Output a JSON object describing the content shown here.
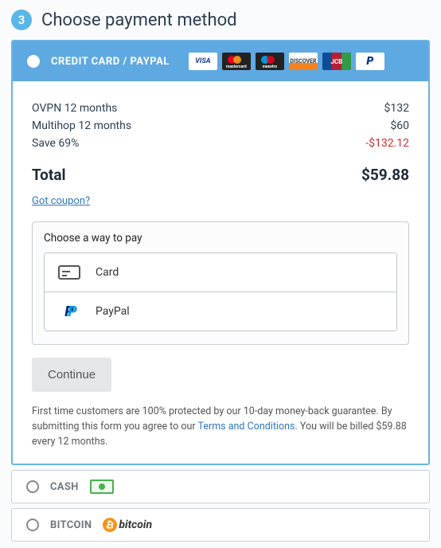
{
  "step": {
    "number": "3",
    "title": "Choose payment method"
  },
  "methods": {
    "credit": "CREDIT CARD / PAYPAL",
    "cash": "CASH",
    "bitcoin": "BITCOIN",
    "bitcoin_brand": "bitcoin"
  },
  "line_items": [
    {
      "label": "OVPN 12 months",
      "value": "$132"
    },
    {
      "label": "Multihop 12 months",
      "value": "$60"
    },
    {
      "label": "Save 69%",
      "value": "-$132.12"
    }
  ],
  "total": {
    "label": "Total",
    "value": "$59.88"
  },
  "coupon_link": "Got coupon?",
  "pay_box": {
    "title": "Choose a way to pay",
    "card": "Card",
    "paypal": "PayPal"
  },
  "continue_label": "Continue",
  "fine_print": {
    "pre": "First time customers are 100% protected by our 10-day money-back guarantee. By submitting this form you agree to our ",
    "terms": "Terms and Conditions",
    "post": ". You will be billed $59.88 every 12 months."
  },
  "card_brands": {
    "visa": "VISA",
    "mastercard": "mastercard",
    "maestro": "maestro",
    "discover": "DISCOVER",
    "jcb": "JCB",
    "paypal": "P"
  }
}
